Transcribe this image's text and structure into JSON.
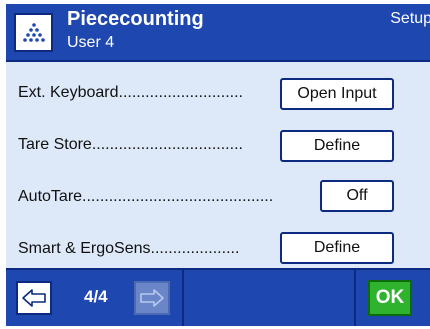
{
  "header": {
    "app_icon": "dots-pyramid-icon",
    "title": "Piececounting",
    "subtitle": "User 4",
    "setup_label": "Setup"
  },
  "rows": [
    {
      "label": "Ext. Keyboard............................",
      "button": "Open Input"
    },
    {
      "label": "Tare Store..................................",
      "button": "Define"
    },
    {
      "label": "AutoTare...........................................",
      "button": "Off"
    },
    {
      "label": "Smart & ErgoSens....................",
      "button": "Define"
    }
  ],
  "footer": {
    "back_icon": "arrow-left-icon",
    "page_indicator": "4/4",
    "forward_icon": "arrow-right-icon",
    "ok_label": "OK"
  },
  "colors": {
    "header_bg": "#1f47b0",
    "content_bg": "#dde8f8",
    "ok_green": "#2fb32f"
  }
}
